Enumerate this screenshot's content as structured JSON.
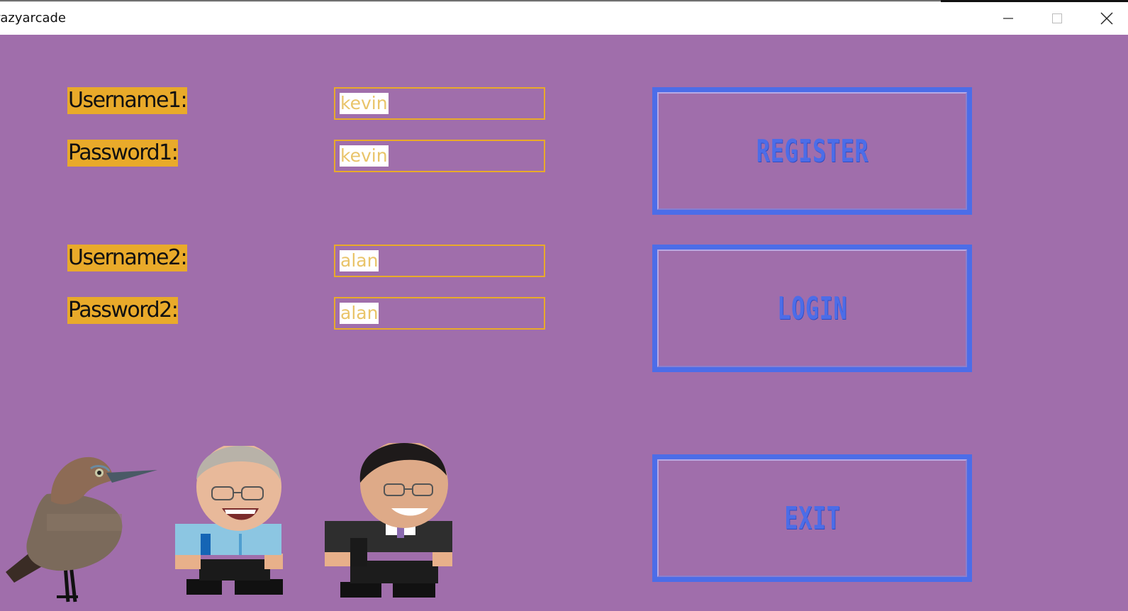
{
  "window": {
    "title": "razyarcade",
    "controls": {
      "minimize_icon": "minimize-icon",
      "maximize_icon": "maximize-icon",
      "close_icon": "close-icon"
    }
  },
  "form": {
    "player1": {
      "username_label": "Username1:",
      "username_value": "kevin",
      "password_label": "Password1:",
      "password_value": "kevin"
    },
    "player2": {
      "username_label": "Username2:",
      "username_value": "alan",
      "password_label": "Password2:",
      "password_value": "alan"
    }
  },
  "buttons": {
    "register": "REGISTER",
    "login": "LOGIN",
    "exit": "EXIT"
  },
  "characters": [
    {
      "icon": "bird-sprite-icon"
    },
    {
      "icon": "player1-character-icon"
    },
    {
      "icon": "player2-character-icon"
    }
  ],
  "colors": {
    "background": "#a06eab",
    "label_bg": "#e9aa2a",
    "button_border": "#4c6de8",
    "input_text": "#e9c46a"
  }
}
